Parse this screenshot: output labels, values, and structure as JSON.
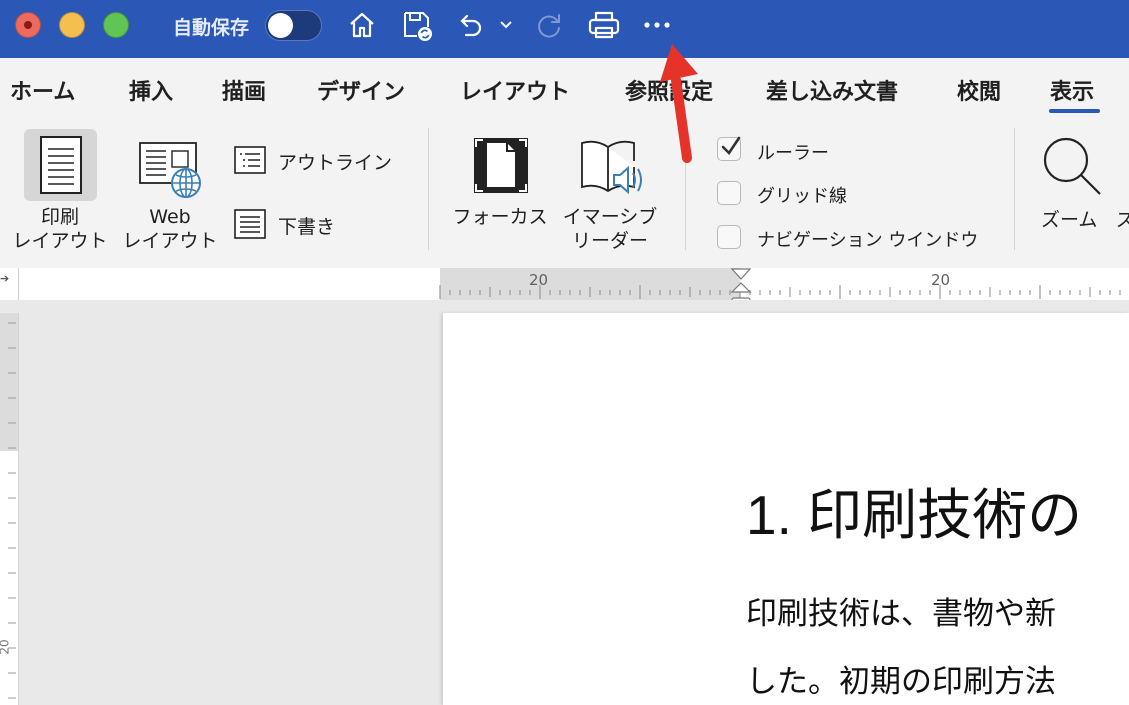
{
  "titlebar": {
    "autosave_label": "自動保存",
    "autosave_on": false,
    "icons": [
      "home-icon",
      "save-sync-icon",
      "undo-icon",
      "undo-dropdown-icon",
      "redo-icon",
      "print-icon",
      "more-icon"
    ],
    "bg_color": "#2b57b7"
  },
  "tabs": [
    {
      "label": "ホーム"
    },
    {
      "label": "挿入"
    },
    {
      "label": "描画"
    },
    {
      "label": "デザイン"
    },
    {
      "label": "レイアウト"
    },
    {
      "label": "参照設定"
    },
    {
      "label": "差し込み文書"
    },
    {
      "label": "校閲"
    },
    {
      "label": "表示",
      "selected": true
    }
  ],
  "ribbon": {
    "print_layout": {
      "line1": "印刷",
      "line2": "レイアウト",
      "active": true
    },
    "web_layout": {
      "line1": "Web",
      "line2": "レイアウト"
    },
    "outline": "アウトライン",
    "draft": "下書き",
    "focus": "フォーカス",
    "immersive": {
      "line1": "イマーシブ",
      "line2": "リーダー"
    },
    "checkboxes": [
      {
        "label": "ルーラー",
        "checked": true
      },
      {
        "label": "グリッド線",
        "checked": false
      },
      {
        "label": "ナビゲーション ウインドウ",
        "checked": false
      }
    ],
    "zoom": "ズーム",
    "zoom_next_partial": "ズ"
  },
  "ruler": {
    "left_number": "20",
    "right_number": "20",
    "vertical_number": "20"
  },
  "document": {
    "heading": "1. 印刷技術の",
    "line1": "印刷技術は、書物や新",
    "line2": "した。初期の印刷方法"
  },
  "annotation": {
    "type": "red-arrow",
    "points_to": "more-icon",
    "color": "#e63329"
  }
}
